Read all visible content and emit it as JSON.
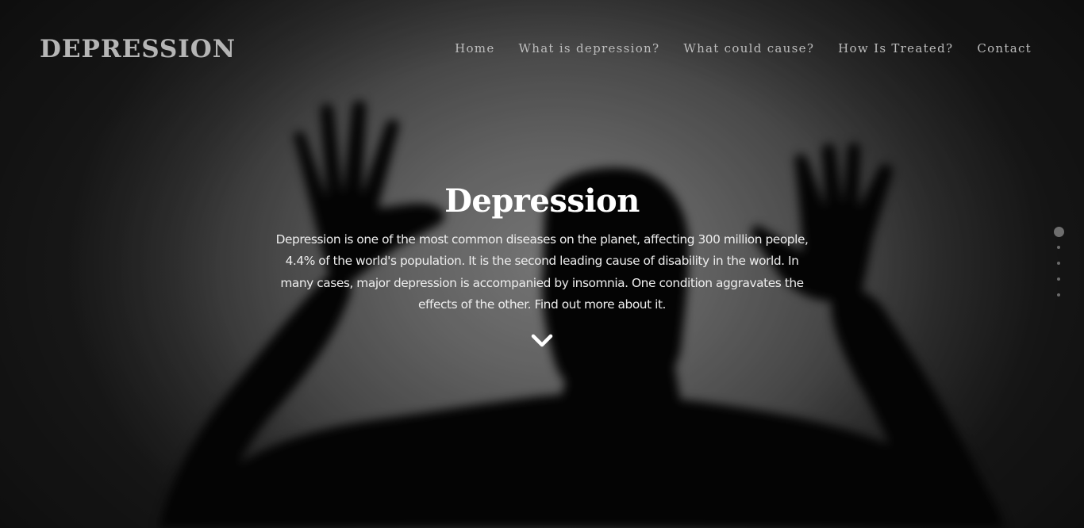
{
  "header": {
    "brand": "DEPRESSION",
    "nav": [
      {
        "label": "Home"
      },
      {
        "label": "What is depression?"
      },
      {
        "label": "What could cause?"
      },
      {
        "label": "How Is Treated?"
      },
      {
        "label": "Contact"
      }
    ]
  },
  "hero": {
    "title": "Depression",
    "text": "Depression is one of the most common diseases on the planet, affecting 300 million people, 4.4% of the world's population. It is the second leading cause of disability in the world. In many cases, major depression is accompanied by insomnia. One condition aggravates the effects of the other. Find out more about it.",
    "scroll_icon": "chevron-down-icon"
  },
  "pagination": {
    "count": 5,
    "active_index": 0
  },
  "colors": {
    "text_white": "#ffffff",
    "nav_text": "#bdbdbd",
    "brand_text": "#b5b5b5"
  }
}
